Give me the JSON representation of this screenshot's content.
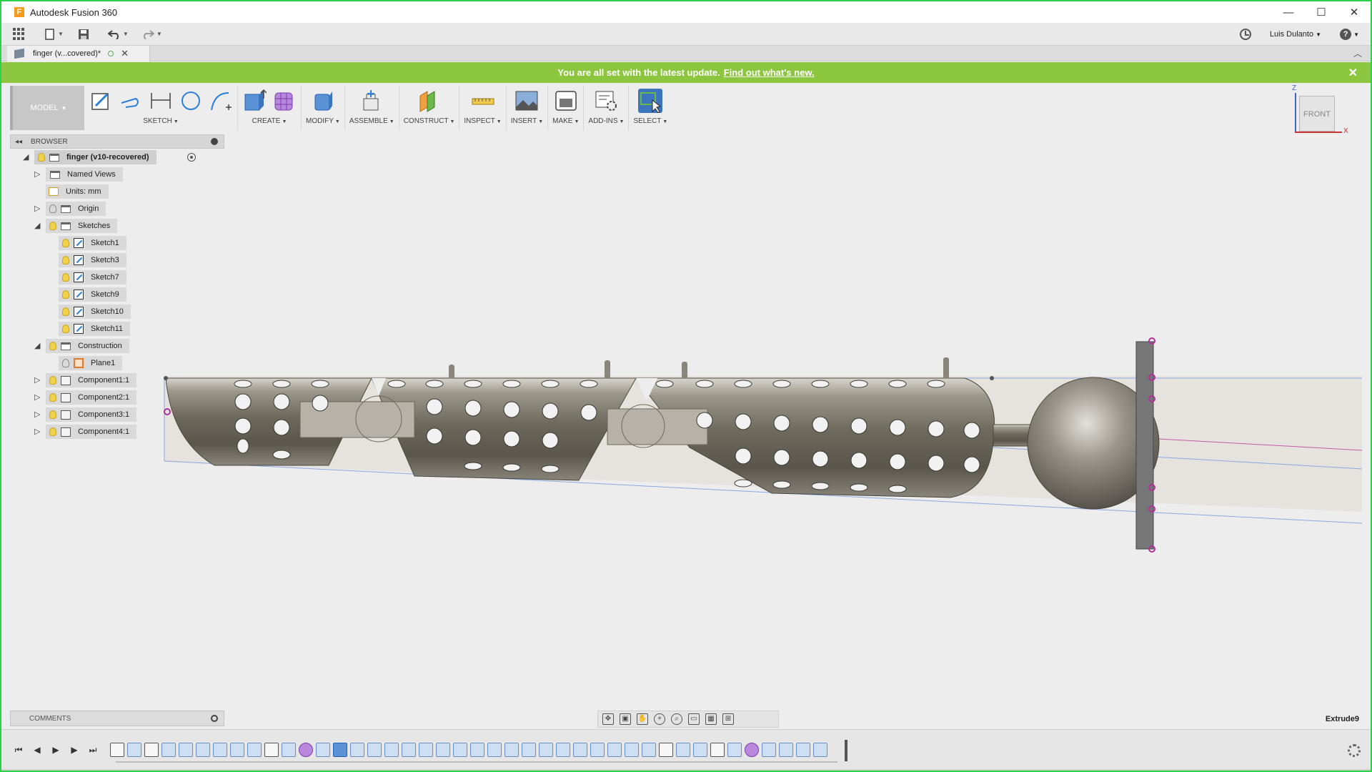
{
  "app": {
    "title": "Autodesk Fusion 360",
    "logo_letter": "F"
  },
  "window_controls": {
    "minimize": "—",
    "maximize": "☐",
    "close": "✕"
  },
  "quick_access": {
    "user": "Luis Dulanto"
  },
  "document_tab": {
    "label": "finger (v...covered)*",
    "close": "✕"
  },
  "banner": {
    "message": "You are all set with the latest update.",
    "link": "Find out what's new.",
    "close": "✕"
  },
  "toolbar": {
    "workspace": "MODEL",
    "groups": [
      {
        "label": "SKETCH",
        "icons": [
          "sketch-create-icon",
          "line-icon",
          "dimension-icon",
          "circle-icon",
          "spline-icon"
        ]
      },
      {
        "label": "CREATE",
        "icons": [
          "extrude-icon",
          "form-icon"
        ]
      },
      {
        "label": "MODIFY",
        "icons": [
          "press-pull-icon"
        ]
      },
      {
        "label": "ASSEMBLE",
        "icons": [
          "new-component-icon"
        ]
      },
      {
        "label": "CONSTRUCT",
        "icons": [
          "offset-plane-icon"
        ]
      },
      {
        "label": "INSPECT",
        "icons": [
          "measure-icon"
        ]
      },
      {
        "label": "INSERT",
        "icons": [
          "insert-image-icon"
        ]
      },
      {
        "label": "MAKE",
        "icons": [
          "3d-print-icon"
        ]
      },
      {
        "label": "ADD-INS",
        "icons": [
          "scripts-icon"
        ]
      },
      {
        "label": "SELECT",
        "icons": [
          "select-icon"
        ]
      }
    ]
  },
  "viewcube": {
    "face": "FRONT",
    "axis_z": "Z",
    "axis_x": "X"
  },
  "browser": {
    "title": "BROWSER",
    "items": [
      {
        "label": "finger (v10-recovered)",
        "level": 0,
        "expander": "open",
        "icon": "root",
        "root": true
      },
      {
        "label": "Named Views",
        "level": 1,
        "expander": "closed",
        "icon": "folder",
        "bulb": false
      },
      {
        "label": "Units: mm",
        "level": 1,
        "expander": "none",
        "icon": "units",
        "bulb": false
      },
      {
        "label": "Origin",
        "level": 1,
        "expander": "closed",
        "icon": "folder",
        "bulb": "off"
      },
      {
        "label": "Sketches",
        "level": 1,
        "expander": "open",
        "icon": "folder",
        "bulb": "on"
      },
      {
        "label": "Sketch1",
        "level": 2,
        "expander": "none",
        "icon": "sketch",
        "bulb": "on"
      },
      {
        "label": "Sketch3",
        "level": 2,
        "expander": "none",
        "icon": "sketch",
        "bulb": "on"
      },
      {
        "label": "Sketch7",
        "level": 2,
        "expander": "none",
        "icon": "sketch",
        "bulb": "on"
      },
      {
        "label": "Sketch9",
        "level": 2,
        "expander": "none",
        "icon": "sketch",
        "bulb": "on"
      },
      {
        "label": "Sketch10",
        "level": 2,
        "expander": "none",
        "icon": "sketch",
        "bulb": "on"
      },
      {
        "label": "Sketch11",
        "level": 2,
        "expander": "none",
        "icon": "sketch",
        "bulb": "on"
      },
      {
        "label": "Construction",
        "level": 1,
        "expander": "open",
        "icon": "folder",
        "bulb": "on"
      },
      {
        "label": "Plane1",
        "level": 2,
        "expander": "none",
        "icon": "plane",
        "bulb": "off"
      },
      {
        "label": "Component1:1",
        "level": 1,
        "expander": "closed",
        "icon": "component",
        "bulb": "on"
      },
      {
        "label": "Component2:1",
        "level": 1,
        "expander": "closed",
        "icon": "component",
        "bulb": "on"
      },
      {
        "label": "Component3:1",
        "level": 1,
        "expander": "closed",
        "icon": "component",
        "bulb": "on"
      },
      {
        "label": "Component4:1",
        "level": 1,
        "expander": "closed",
        "icon": "component",
        "bulb": "on"
      }
    ]
  },
  "comments": {
    "title": "COMMENTS"
  },
  "status": {
    "current_feature": "Extrude9"
  },
  "timeline": {
    "features": [
      "sketch",
      "extrude",
      "sketch",
      "extrude",
      "extrude",
      "fillet",
      "shell",
      "extrude",
      "hole",
      "sketch",
      "extrude",
      "move",
      "combine",
      "active",
      "extrude",
      "extrude",
      "extrude",
      "extrude",
      "extrude",
      "extrude",
      "extrude",
      "extrude",
      "extrude",
      "extrude",
      "extrude",
      "extrude",
      "extrude",
      "extrude",
      "extrude",
      "extrude",
      "extrude",
      "extrude",
      "sketch",
      "extrude",
      "extrude",
      "sketch",
      "extrude",
      "move",
      "extrude",
      "extrude",
      "extrude",
      "extrude"
    ]
  },
  "colors": {
    "banner": "#8cc63f",
    "frame": "#2bd14a",
    "accent": "#1c5fb5"
  }
}
